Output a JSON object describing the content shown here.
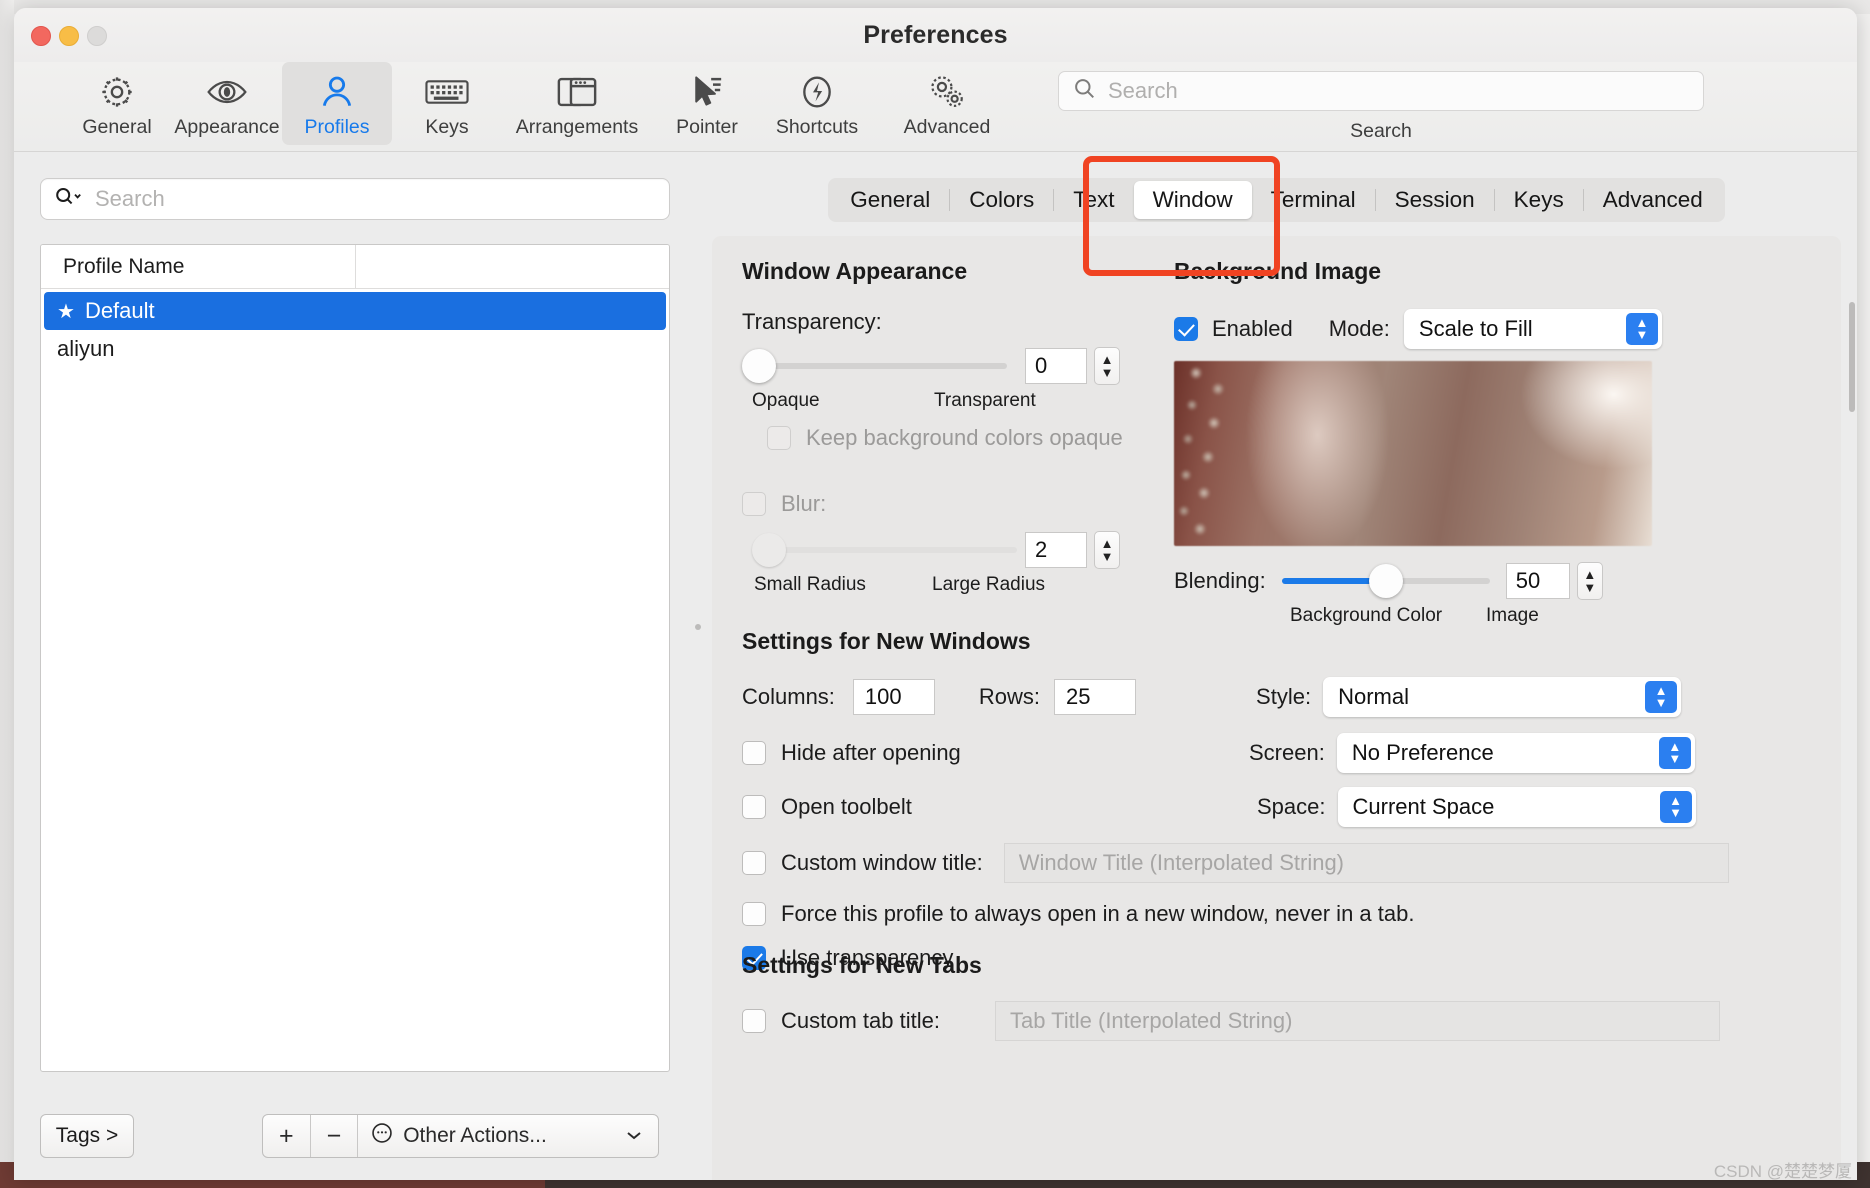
{
  "window": {
    "title": "Preferences",
    "traffic_lights": [
      "close",
      "minimize",
      "zoom"
    ]
  },
  "toolbar": {
    "items": [
      {
        "label": "General",
        "icon": "gear-icon"
      },
      {
        "label": "Appearance",
        "icon": "eye-icon"
      },
      {
        "label": "Profiles",
        "icon": "person-icon",
        "selected": true
      },
      {
        "label": "Keys",
        "icon": "keyboard-icon"
      },
      {
        "label": "Arrangements",
        "icon": "windows-icon"
      },
      {
        "label": "Pointer",
        "icon": "cursor-icon"
      },
      {
        "label": "Shortcuts",
        "icon": "bolt-icon"
      },
      {
        "label": "Advanced",
        "icon": "gears-icon"
      }
    ],
    "search": {
      "placeholder": "Search",
      "caption": "Search",
      "icon": "search-icon"
    }
  },
  "sidebar": {
    "search": {
      "placeholder": "Search",
      "icon": "search-dropdown-icon"
    },
    "table": {
      "columns": [
        "Profile Name",
        ""
      ],
      "rows": [
        {
          "name": "Default",
          "starred": true,
          "selected": true
        },
        {
          "name": "aliyun",
          "starred": false,
          "selected": false
        }
      ]
    },
    "footer": {
      "tags_label": "Tags >",
      "add_label": "+",
      "remove_label": "−",
      "other_actions_label": "Other Actions...",
      "other_actions_icon": "ellipsis-circle-icon",
      "chevron_icon": "chevron-down-icon"
    }
  },
  "tabs": {
    "items": [
      {
        "label": "General",
        "active": false
      },
      {
        "label": "Colors",
        "active": false
      },
      {
        "label": "Text",
        "active": false
      },
      {
        "label": "Window",
        "active": true
      },
      {
        "label": "Terminal",
        "active": false
      },
      {
        "label": "Session",
        "active": false
      },
      {
        "label": "Keys",
        "active": false
      },
      {
        "label": "Advanced",
        "active": false
      }
    ]
  },
  "annotation": {
    "color": "#f04322",
    "target": "Window"
  },
  "window_appearance": {
    "title": "Window Appearance",
    "transparency": {
      "label": "Transparency:",
      "value": "0",
      "percent": 0,
      "min_label": "Opaque",
      "max_label": "Transparent"
    },
    "keep_bg_opaque": {
      "label": "Keep background colors opaque",
      "checked": false,
      "enabled": false
    },
    "blur": {
      "label": "Blur:",
      "checked": false,
      "enabled": false,
      "value": "2",
      "percent": 2,
      "min_label": "Small Radius",
      "max_label": "Large Radius"
    }
  },
  "background_image": {
    "title": "Background Image",
    "enabled": {
      "label": "Enabled",
      "checked": true
    },
    "mode": {
      "label": "Mode:",
      "value": "Scale to Fill"
    },
    "preview_alt": "background-image-preview",
    "blending": {
      "label": "Blending:",
      "value": "50",
      "percent": 50,
      "min_label": "Background Color",
      "max_label": "Image"
    }
  },
  "new_windows": {
    "title": "Settings for New Windows",
    "columns": {
      "label": "Columns:",
      "value": "100"
    },
    "rows": {
      "label": "Rows:",
      "value": "25"
    },
    "style": {
      "label": "Style:",
      "value": "Normal"
    },
    "screen": {
      "label": "Screen:",
      "value": "No Preference"
    },
    "space": {
      "label": "Space:",
      "value": "Current Space"
    },
    "checkboxes": [
      {
        "label": "Hide after opening",
        "checked": false
      },
      {
        "label": "Open toolbelt",
        "checked": false
      }
    ],
    "custom_window_title": {
      "label": "Custom window title:",
      "checked": false,
      "placeholder": "Window Title (Interpolated String)"
    },
    "force_new_window": {
      "label": "Force this profile to always open in a new window, never in a tab.",
      "checked": false
    },
    "use_transparency": {
      "label": "Use transparency",
      "checked": true
    }
  },
  "new_tabs": {
    "title": "Settings for New Tabs",
    "custom_tab_title": {
      "label": "Custom tab title:",
      "checked": false,
      "placeholder": "Tab Title (Interpolated String)"
    }
  },
  "watermark": "CSDN @楚楚梦厦"
}
